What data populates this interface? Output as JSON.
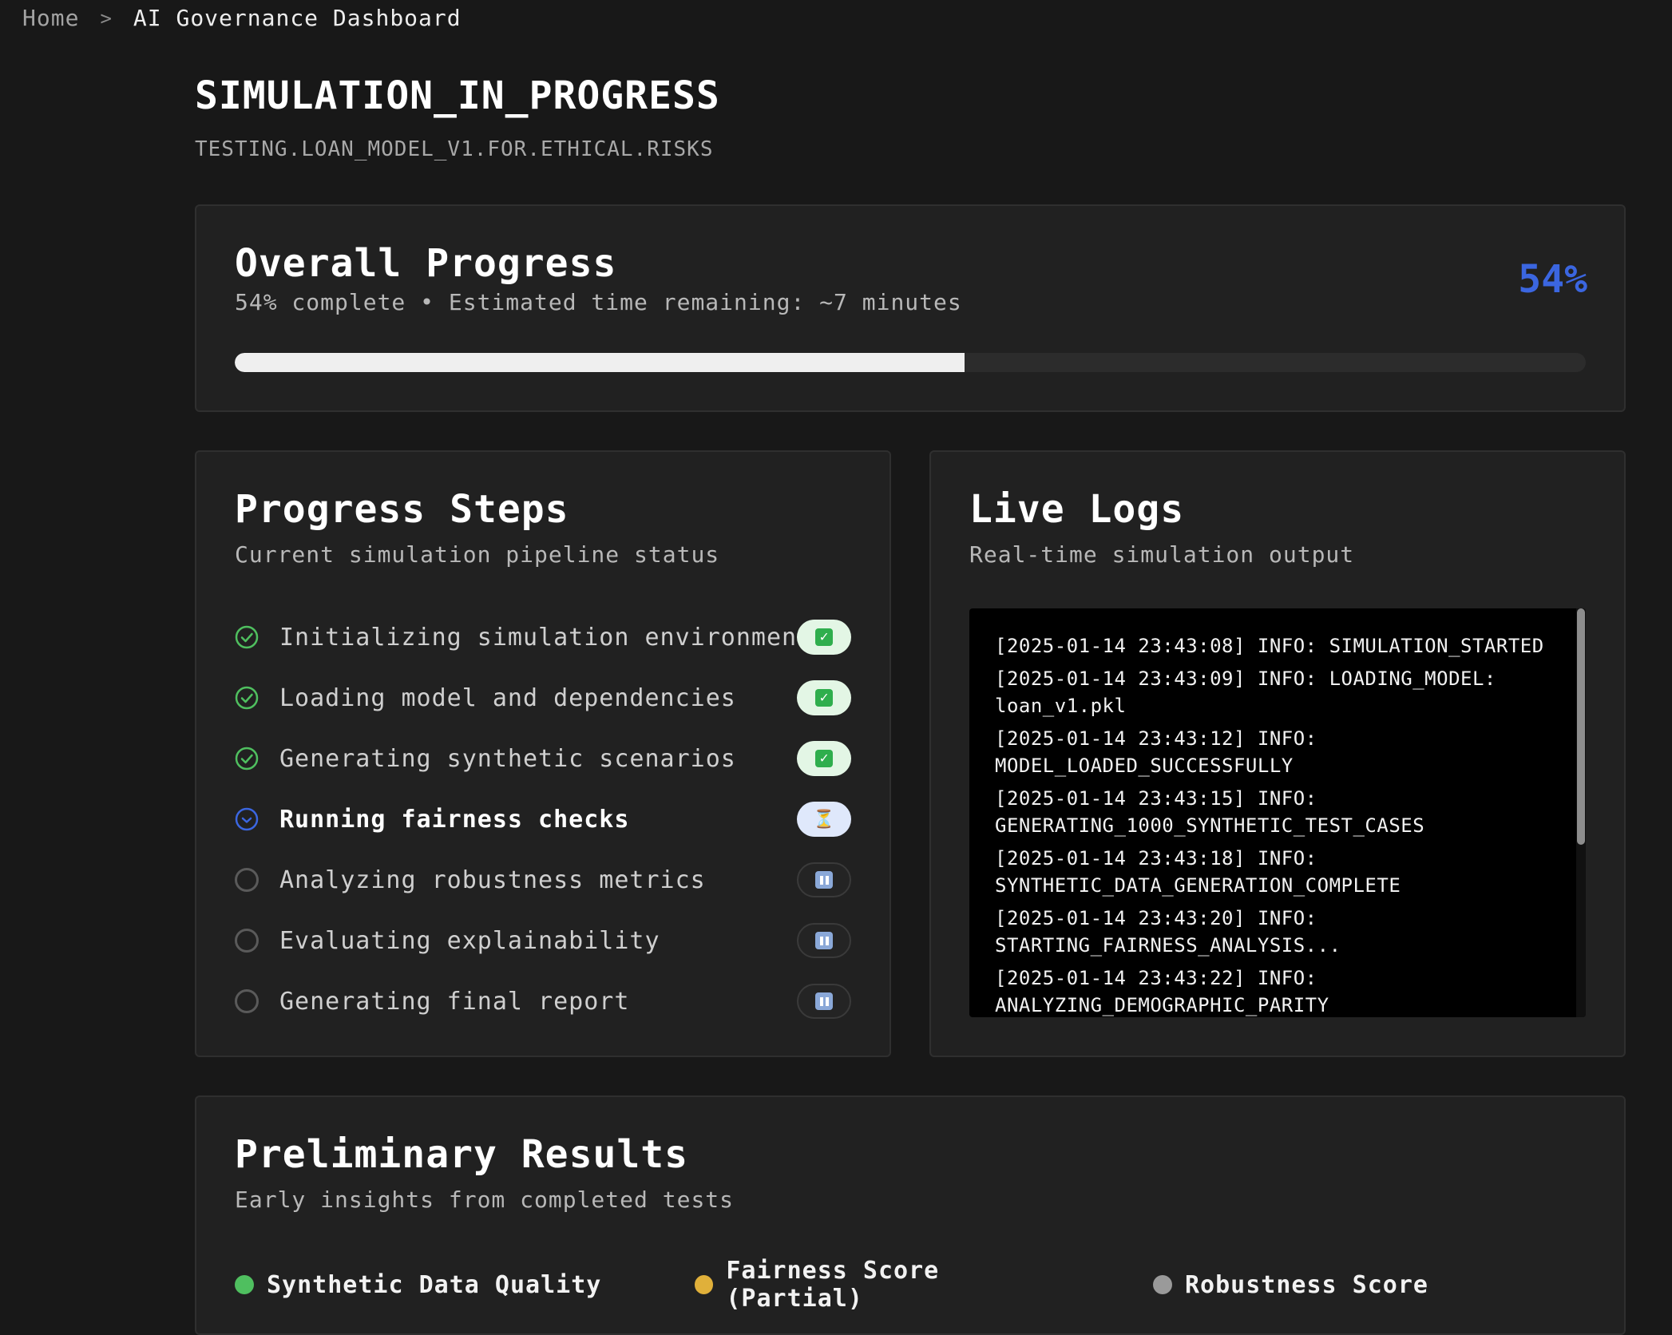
{
  "breadcrumb": {
    "home": "Home",
    "separator": ">",
    "current": "AI Governance Dashboard"
  },
  "header": {
    "title": "SIMULATION_IN_PROGRESS",
    "subtitle": "TESTING.LOAN_MODEL_V1.FOR.ETHICAL.RISKS"
  },
  "overall": {
    "title": "Overall Progress",
    "description": "54% complete • Estimated time remaining: ~7 minutes",
    "percent_label": "54%",
    "progress_fraction": 0.54,
    "accent_color": "#3b66e0"
  },
  "steps": {
    "title": "Progress Steps",
    "description": "Current simulation pipeline status",
    "items": [
      {
        "label": "Initializing simulation environment",
        "status": "done",
        "badge_icon": "check-mark-icon"
      },
      {
        "label": "Loading model and dependencies",
        "status": "done",
        "badge_icon": "check-mark-icon"
      },
      {
        "label": "Generating synthetic scenarios",
        "status": "done",
        "badge_icon": "check-mark-icon"
      },
      {
        "label": "Running fairness checks",
        "status": "active",
        "badge_icon": "hourglass-icon"
      },
      {
        "label": "Analyzing robustness metrics",
        "status": "pending",
        "badge_icon": "pause-icon"
      },
      {
        "label": "Evaluating explainability",
        "status": "pending",
        "badge_icon": "pause-icon"
      },
      {
        "label": "Generating final report",
        "status": "pending",
        "badge_icon": "pause-icon"
      }
    ]
  },
  "logs": {
    "title": "Live Logs",
    "description": "Real-time simulation output",
    "lines": [
      "[2025-01-14 23:43:08] INFO: SIMULATION_STARTED",
      "[2025-01-14 23:43:09] INFO: LOADING_MODEL: loan_v1.pkl",
      "[2025-01-14 23:43:12] INFO: MODEL_LOADED_SUCCESSFULLY",
      "[2025-01-14 23:43:15] INFO: GENERATING_1000_SYNTHETIC_TEST_CASES",
      "[2025-01-14 23:43:18] INFO: SYNTHETIC_DATA_GENERATION_COMPLETE",
      "[2025-01-14 23:43:20] INFO: STARTING_FAIRNESS_ANALYSIS...",
      "[2025-01-14 23:43:22] INFO: ANALYZING_DEMOGRAPHIC_PARITY"
    ]
  },
  "results": {
    "title": "Preliminary Results",
    "description": "Early insights from completed tests",
    "items": [
      {
        "label": "Synthetic Data Quality",
        "color": "#4fbf5f"
      },
      {
        "label": "Fairness Score (Partial)",
        "color": "#e0b03a"
      },
      {
        "label": "Robustness Score",
        "color": "#9a9a9a"
      }
    ]
  }
}
